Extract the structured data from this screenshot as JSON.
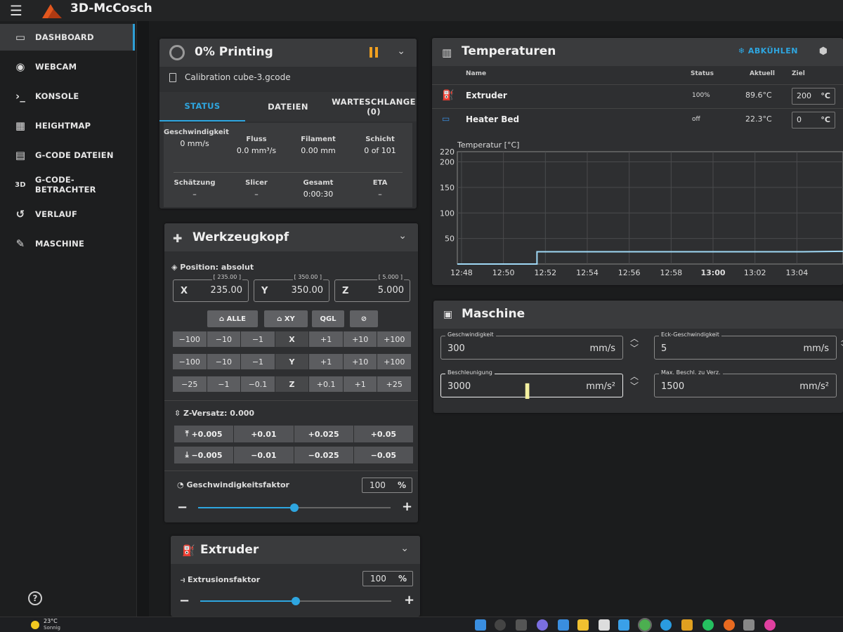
{
  "app": {
    "title": "3D-McCosch"
  },
  "sidebar": {
    "items": [
      {
        "label": "DASHBOARD",
        "icon": "monitor-icon",
        "active": true
      },
      {
        "label": "WEBCAM",
        "icon": "webcam-icon",
        "active": false
      },
      {
        "label": "KONSOLE",
        "icon": "console-icon",
        "active": false
      },
      {
        "label": "HEIGHTMAP",
        "icon": "grid-icon",
        "active": false
      },
      {
        "label": "G-CODE DATEIEN",
        "icon": "file-icon",
        "active": false
      },
      {
        "label": "G-CODE-BETRACHTER",
        "icon": "3d-icon",
        "active": false
      },
      {
        "label": "VERLAUF",
        "icon": "history-icon",
        "active": false
      },
      {
        "label": "MASCHINE",
        "icon": "wrench-icon",
        "active": false
      }
    ],
    "icon_glyphs": [
      "▭",
      "◉",
      "›_",
      "▦",
      "▤",
      "3D",
      "↺",
      "✎"
    ],
    "help": "?"
  },
  "status": {
    "title": "0% Printing",
    "filename": "Calibration cube-3.gcode",
    "tabs": [
      "STATUS",
      "DATEIEN",
      "WARTESCHLANGE (0)"
    ],
    "stats_row1": [
      {
        "label": "Geschwindigkeit",
        "value": "0 mm/s"
      },
      {
        "label": "Fluss",
        "value": "0.0 mm³/s"
      },
      {
        "label": "Filament",
        "value": "0.00 mm"
      },
      {
        "label": "Schicht",
        "value": "0 of 101"
      }
    ],
    "stats_row2": [
      {
        "label": "Schätzung",
        "value": "–"
      },
      {
        "label": "Slicer",
        "value": "–"
      },
      {
        "label": "Gesamt",
        "value": "0:00:30"
      },
      {
        "label": "ETA",
        "value": "–"
      }
    ]
  },
  "toolhead": {
    "title": "Werkzeugkopf",
    "position_label": "Position: absolut",
    "coords": [
      {
        "axis": "X",
        "value": "235.00",
        "max": "[ 235.00 ]"
      },
      {
        "axis": "Y",
        "value": "350.00",
        "max": "[ 350.00 ]"
      },
      {
        "axis": "Z",
        "value": "5.000",
        "max": "[ 5.000 ]"
      }
    ],
    "home_buttons": {
      "all": "ALLE",
      "xy": "XY",
      "qgl": "QGL"
    },
    "jog_x": [
      "−100",
      "−10",
      "−1",
      "X",
      "+1",
      "+10",
      "+100"
    ],
    "jog_y": [
      "−100",
      "−10",
      "−1",
      "Y",
      "+1",
      "+10",
      "+100"
    ],
    "jog_z": [
      "−25",
      "−1",
      "−0.1",
      "Z",
      "+0.1",
      "+1",
      "+25"
    ],
    "zoffset_label": "Z-Versatz: 0.000",
    "z_up": [
      "+0.005",
      "+0.01",
      "+0.025",
      "+0.05"
    ],
    "z_down": [
      "−0.005",
      "−0.01",
      "−0.025",
      "−0.05"
    ],
    "speed_factor_label": "Geschwindigkeitsfaktor",
    "speed_factor": "100",
    "speed_factor_unit": "%",
    "speed_factor_fraction": 0.5,
    "minus": "−",
    "plus": "+"
  },
  "extruder": {
    "title": "Extruder",
    "factor_label": "Extrusionsfaktor",
    "factor": "100",
    "factor_unit": "%",
    "factor_fraction": 0.5
  },
  "temperatures": {
    "title": "Temperaturen",
    "cool_label": "ABKÜHLEN",
    "headers": {
      "name": "Name",
      "status": "Status",
      "current": "Aktuell",
      "target": "Ziel"
    },
    "rows": [
      {
        "name": "Extruder",
        "status": "100%",
        "current": "89.6°C",
        "target": "200",
        "unit": "°C"
      },
      {
        "name": "Heater Bed",
        "status": "off",
        "current": "22.3°C",
        "target": "0",
        "unit": "°C"
      }
    ]
  },
  "chart_data": {
    "type": "line",
    "ylabel": "Temperatur [°C]",
    "ylim": [
      0,
      220
    ],
    "yticks": [
      50,
      100,
      150,
      200,
      220
    ],
    "x": [
      "12:48",
      "12:50",
      "12:52",
      "12:54",
      "12:56",
      "12:58",
      "13:00",
      "13:02",
      "13:04"
    ],
    "grid": true,
    "series": [
      {
        "values": [
          [
            -0.1,
            0
          ],
          [
            1.8,
            0
          ],
          [
            1.8,
            24
          ],
          [
            8.0,
            24
          ],
          [
            9.1,
            25
          ]
        ],
        "color": "#9fd8f5"
      }
    ],
    "xrange": [
      -0.1,
      9.1
    ]
  },
  "machine": {
    "title": "Maschine",
    "fields": [
      {
        "label": "Geschwindigkeit",
        "value": "300",
        "unit": "mm/s"
      },
      {
        "label": "Eck-Geschwindigkeit",
        "value": "5",
        "unit": "mm/s"
      },
      {
        "label": "Beschleunigung",
        "value": "3000",
        "unit": "mm/s²"
      },
      {
        "label": "Max. Beschl. zu Verz.",
        "value": "1500",
        "unit": "mm/s²"
      }
    ]
  },
  "taskbar": {
    "weather_temp": "23°C",
    "weather_desc": "Sonnig"
  }
}
